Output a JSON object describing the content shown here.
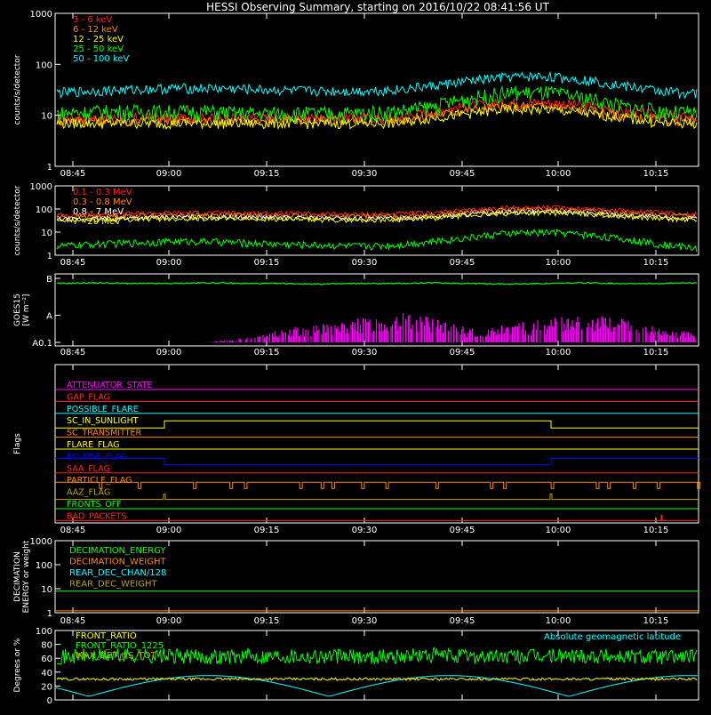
{
  "title": "HESSI Observing Summary, starting on 2016/10/22 08:41:56 UT",
  "colors": {
    "background": "#000000",
    "axes": "#ffffff",
    "red": "#ff2020",
    "orange": "#ff8800",
    "yellow": "#ffff00",
    "green": "#00ff00",
    "cyan": "#00ffff",
    "magenta": "#ff00ff",
    "blue": "#0000ff",
    "olive": "#bba000",
    "pink": "#ff3030"
  },
  "time_ticks": [
    "08:45",
    "09:00",
    "09:15",
    "09:30",
    "09:45",
    "10:00",
    "10:15"
  ],
  "chart_data": [
    {
      "id": "lightcurve",
      "type": "line",
      "ylabel": "counts/s/detector",
      "yscale": "log",
      "ylim": [
        1,
        1000
      ],
      "ytick_labels": [
        "1",
        "10",
        "100",
        "1000"
      ],
      "series": [
        {
          "name": "3 - 6 keV",
          "color": "#ff2020",
          "values": [
            9,
            9,
            9,
            9,
            9,
            9,
            9,
            9,
            9,
            9,
            12,
            16,
            18,
            18,
            16,
            12,
            10,
            9
          ]
        },
        {
          "name": "6 - 12 keV",
          "color": "#ff8800",
          "values": [
            8,
            8,
            8,
            8,
            8,
            8,
            8,
            8,
            8,
            8,
            10,
            13,
            15,
            15,
            13,
            10,
            8,
            8
          ]
        },
        {
          "name": "12 - 25 keV",
          "color": "#ffff00",
          "values": [
            7,
            7,
            7,
            7,
            7,
            7,
            7,
            7,
            7,
            7,
            9,
            11,
            13,
            13,
            11,
            9,
            7,
            7
          ]
        },
        {
          "name": "25 - 50 keV",
          "color": "#00ff00",
          "values": [
            11,
            12,
            12,
            12,
            12,
            11,
            11,
            11,
            11,
            12,
            15,
            22,
            28,
            28,
            22,
            15,
            12,
            11
          ]
        },
        {
          "name": "50 - 100 keV",
          "color": "#00ffff",
          "values": [
            28,
            30,
            32,
            34,
            34,
            33,
            31,
            30,
            30,
            32,
            38,
            48,
            57,
            58,
            50,
            38,
            30,
            27
          ]
        }
      ]
    },
    {
      "id": "highenergy",
      "type": "line",
      "ylabel": "counts/s/detector",
      "yscale": "log",
      "ylim": [
        1,
        1000
      ],
      "ytick_labels": [
        "1",
        "10",
        "100",
        "1000"
      ],
      "series": [
        {
          "name": "0.1 - 0.3 MeV",
          "color": "#ff2020",
          "values": [
            55,
            60,
            65,
            68,
            70,
            68,
            65,
            62,
            60,
            62,
            70,
            90,
            115,
            118,
            105,
            85,
            70,
            60
          ]
        },
        {
          "name": "0.3 - 0.8 MeV",
          "color": "#ff8800",
          "values": [
            45,
            48,
            52,
            55,
            56,
            55,
            52,
            50,
            48,
            50,
            58,
            75,
            92,
            94,
            84,
            68,
            55,
            48
          ]
        },
        {
          "name": "0.8 - 7 MeV",
          "color": "#ffffff",
          "values": [
            35,
            38,
            42,
            44,
            45,
            44,
            42,
            40,
            38,
            40,
            46,
            60,
            75,
            78,
            68,
            55,
            44,
            38
          ]
        },
        {
          "name": "7 - 20 MeV",
          "color": "#ffff00",
          "values": [
            30,
            33,
            36,
            38,
            39,
            38,
            36,
            34,
            33,
            35,
            40,
            52,
            65,
            68,
            60,
            48,
            38,
            33
          ]
        },
        {
          "name": "",
          "color": "#00ff00",
          "values": [
            2.5,
            3,
            3.5,
            4,
            4,
            3.5,
            3,
            2.8,
            2.5,
            2.8,
            4,
            6,
            9,
            10,
            8,
            5,
            3,
            2
          ]
        }
      ]
    },
    {
      "id": "goes",
      "type": "line",
      "ylabel": "GOES15",
      "ylabel2": "[W m⁻²]",
      "ytick_labels": [
        "A0.1",
        "A",
        "B"
      ],
      "series": [
        {
          "name": "",
          "color": "#00ff00",
          "values": [
            0.92,
            0.93,
            0.92,
            0.92,
            0.93,
            0.92,
            0.92,
            0.91,
            0.92,
            0.92,
            0.93,
            0.92,
            0.91,
            0.92,
            0.93,
            0.92,
            0.92,
            0.93
          ]
        },
        {
          "name": "",
          "color": "#ff00ff",
          "values": [
            0.0,
            0.0,
            0.0,
            0.0,
            0.0,
            0.05,
            0.15,
            0.2,
            0.25,
            0.35,
            0.25,
            0.15,
            0.2,
            0.25,
            0.3,
            0.25,
            0.15,
            0.1
          ]
        }
      ]
    },
    {
      "id": "flags",
      "type": "line",
      "ylabel": "Flags",
      "series": [
        {
          "name": "ATTENUATOR_STATE",
          "color": "#ff00ff"
        },
        {
          "name": "GAP_FLAG",
          "color": "#ff3030"
        },
        {
          "name": "POSSIBLE_FLARE",
          "color": "#00ffff"
        },
        {
          "name": "SC_IN_SUNLIGHT",
          "color": "#ffff00"
        },
        {
          "name": "SC_TRANSMITTER",
          "color": "#ff8800"
        },
        {
          "name": "FLARE_FLAG",
          "color": "#ffff00"
        },
        {
          "name": "ECLIPSE_FLAG",
          "color": "#0000ff"
        },
        {
          "name": "SAA_FLAG",
          "color": "#ff2020"
        },
        {
          "name": "PARTICLE_FLAG",
          "color": "#ff8800"
        },
        {
          "name": "AAZ_FLAG",
          "color": "#bba000"
        },
        {
          "name": "FRONTS_OFF",
          "color": "#00ff00"
        },
        {
          "name": "BAD_PACKETS",
          "color": "#ff2020"
        }
      ]
    },
    {
      "id": "decimation",
      "type": "line",
      "ylabel": "DECIMATION",
      "ylabel2": "ENERGY or weight",
      "yscale": "log",
      "ylim": [
        1,
        1000
      ],
      "ytick_labels": [
        "1",
        "10",
        "100",
        "1000"
      ],
      "series": [
        {
          "name": "DECIMATION_ENERGY",
          "color": "#00ff00",
          "values": [
            8,
            8
          ]
        },
        {
          "name": "DECIMATION_WEIGHT",
          "color": "#ff8800",
          "values": [
            1.2,
            1.2
          ]
        },
        {
          "name": "REAR_DEC_CHAN/128",
          "color": "#00ffff",
          "values": []
        },
        {
          "name": "REAR_DEC_WEIGHT",
          "color": "#bba000",
          "values": []
        }
      ]
    },
    {
      "id": "ratio",
      "type": "line",
      "ylabel": "Degrees or %",
      "ylim": [
        0,
        100
      ],
      "ytick_labels": [
        "0",
        "20",
        "40",
        "60",
        "80",
        "100"
      ],
      "series": [
        {
          "name": "FRONT_RATIO",
          "color": "#ffff00",
          "values": [
            30,
            30,
            30,
            30,
            30,
            30,
            30,
            30,
            30,
            30,
            30,
            30,
            30,
            30,
            30,
            30,
            30,
            30
          ]
        },
        {
          "name": "FRONT_RATIO_1225",
          "color": "#00ff00",
          "values": [
            62,
            63,
            64,
            63,
            62,
            63,
            64,
            63,
            62,
            63,
            64,
            63,
            62,
            63,
            64,
            63,
            62,
            63
          ]
        },
        {
          "name": "MAX_DET_VS_TOT",
          "color": "#bba000",
          "values": []
        },
        {
          "name": "Absolute geomagnetic latitude",
          "color": "#00ffff",
          "values": []
        }
      ]
    }
  ]
}
